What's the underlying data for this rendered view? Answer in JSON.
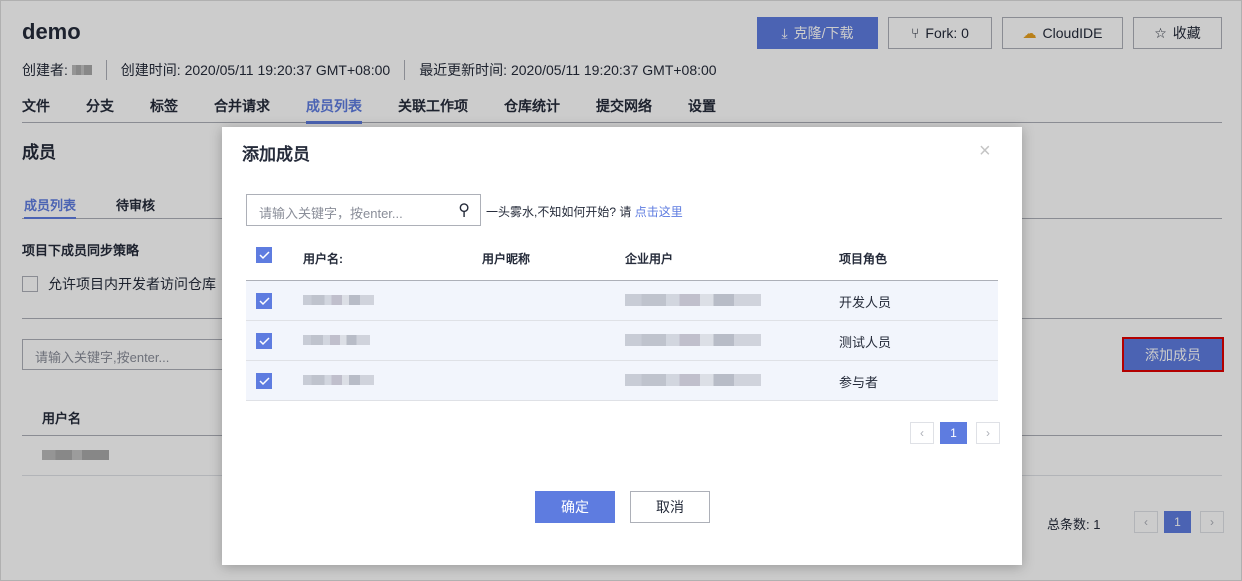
{
  "repo": {
    "title": "demo",
    "buttons": {
      "clone": "克隆/下载",
      "fork": "Fork: 0",
      "cloudide": "CloudIDE",
      "favorite": "收藏"
    },
    "meta": {
      "creator_label": "创建者:",
      "created_label": "创建时间:",
      "created": "2020/05/11 19:20:37 GMT+08:00",
      "updated_label": "最近更新时间:",
      "updated": "2020/05/11 19:20:37 GMT+08:00"
    },
    "nav": [
      "文件",
      "分支",
      "标签",
      "合并请求",
      "成员列表",
      "关联工作项",
      "仓库统计",
      "提交网络",
      "设置"
    ]
  },
  "members": {
    "heading": "成员",
    "tabs": [
      "成员列表",
      "待审核"
    ],
    "sync_title": "项目下成员同步策略",
    "sync_option": "允许项目内开发者访问仓库",
    "search_placeholder": "请输入关键字,按enter...",
    "add_button": "添加成员",
    "col_username": "用户名",
    "total": "总条数: 1",
    "page": "1"
  },
  "dialog": {
    "title": "添加成员",
    "search_placeholder": "请输入关键字，按enter...",
    "hint": "一头雾水,不知如何开始? 请",
    "hint_link": "点击这里",
    "columns": [
      "用户名:",
      "用户昵称",
      "企业用户",
      "项目角色"
    ],
    "rows": [
      {
        "role": "开发人员",
        "checked": true
      },
      {
        "role": "测试人员",
        "checked": true
      },
      {
        "role": "参与者",
        "checked": true
      }
    ],
    "page": "1",
    "confirm": "确定",
    "cancel": "取消"
  },
  "colors": {
    "accent": "#5e7ce0",
    "highlight": "#e00000"
  }
}
